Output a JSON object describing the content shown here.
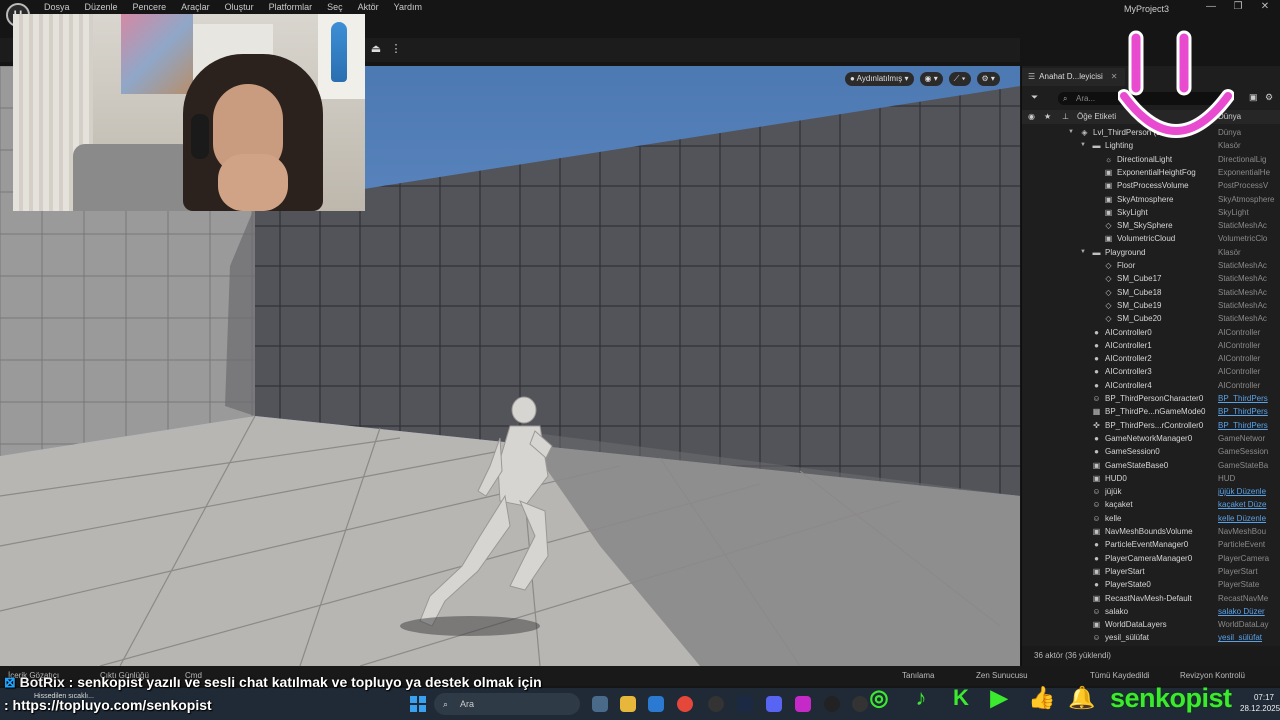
{
  "app": {
    "logo": "U",
    "menus": [
      "Dosya",
      "Düzenle",
      "Pencere",
      "Araçlar",
      "Oluştur",
      "Platformlar",
      "Seç",
      "Aktör",
      "Yardım"
    ],
    "project": "MyProject3",
    "window_controls": [
      "—",
      "❐",
      "✕"
    ]
  },
  "viewport": {
    "lit_mode": "Aydınlatılmış",
    "toolbar_icons": [
      "eye-icon",
      "transform-icon",
      "settings-icon"
    ]
  },
  "outliner": {
    "tab_label": "Anahat D...leyicisi",
    "search_placeholder": "Ara...",
    "header_label": "Öğe Etiketi",
    "header_type": "Dünya",
    "rows": [
      {
        "name": "Lvl_ThirdPerson (Editör)",
        "type": "Dünya",
        "depth": 0,
        "kind": "world",
        "expand": true,
        "link": false
      },
      {
        "name": "Lighting",
        "type": "Klasör",
        "depth": 1,
        "kind": "folder",
        "expand": true,
        "link": false
      },
      {
        "name": "DirectionalLight",
        "type": "DirectionalLig",
        "depth": 2,
        "kind": "light",
        "link": false
      },
      {
        "name": "ExponentialHeightFog",
        "type": "ExponentialHe",
        "depth": 2,
        "kind": "actor",
        "link": false
      },
      {
        "name": "PostProcessVolume",
        "type": "PostProcessV",
        "depth": 2,
        "kind": "actor",
        "link": false
      },
      {
        "name": "SkyAtmosphere",
        "type": "SkyAtmosphere",
        "depth": 2,
        "kind": "actor",
        "link": false
      },
      {
        "name": "SkyLight",
        "type": "SkyLight",
        "depth": 2,
        "kind": "actor",
        "link": false
      },
      {
        "name": "SM_SkySphere",
        "type": "StaticMeshAc",
        "depth": 2,
        "kind": "mesh",
        "link": false
      },
      {
        "name": "VolumetricCloud",
        "type": "VolumetricClo",
        "depth": 2,
        "kind": "actor",
        "link": false
      },
      {
        "name": "Playground",
        "type": "Klasör",
        "depth": 1,
        "kind": "folder",
        "expand": true,
        "link": false
      },
      {
        "name": "Floor",
        "type": "StaticMeshAc",
        "depth": 2,
        "kind": "mesh",
        "link": false
      },
      {
        "name": "SM_Cube17",
        "type": "StaticMeshAc",
        "depth": 2,
        "kind": "mesh",
        "link": false
      },
      {
        "name": "SM_Cube18",
        "type": "StaticMeshAc",
        "depth": 2,
        "kind": "mesh",
        "link": false
      },
      {
        "name": "SM_Cube19",
        "type": "StaticMeshAc",
        "depth": 2,
        "kind": "mesh",
        "link": false
      },
      {
        "name": "SM_Cube20",
        "type": "StaticMeshAc",
        "depth": 2,
        "kind": "mesh",
        "link": false
      },
      {
        "name": "AIController0",
        "type": "AIController",
        "depth": 1,
        "kind": "controller",
        "link": false
      },
      {
        "name": "AIController1",
        "type": "AIController",
        "depth": 1,
        "kind": "controller",
        "link": false
      },
      {
        "name": "AIController2",
        "type": "AIController",
        "depth": 1,
        "kind": "controller",
        "link": false
      },
      {
        "name": "AIController3",
        "type": "AIController",
        "depth": 1,
        "kind": "controller",
        "link": false
      },
      {
        "name": "AIController4",
        "type": "AIController",
        "depth": 1,
        "kind": "controller",
        "link": false
      },
      {
        "name": "BP_ThirdPersonCharacter0",
        "type": "BP_ThirdPers",
        "depth": 1,
        "kind": "pawn",
        "link": true
      },
      {
        "name": "BP_ThirdPe...nGameMode0",
        "type": "BP_ThirdPers",
        "depth": 1,
        "kind": "gamemode",
        "link": true
      },
      {
        "name": "BP_ThirdPers...rController0",
        "type": "BP_ThirdPers",
        "depth": 1,
        "kind": "gamepad",
        "link": true
      },
      {
        "name": "GameNetworkManager0",
        "type": "GameNetwor",
        "depth": 1,
        "kind": "controller",
        "link": false
      },
      {
        "name": "GameSession0",
        "type": "GameSession",
        "depth": 1,
        "kind": "controller",
        "link": false
      },
      {
        "name": "GameStateBase0",
        "type": "GameStateBa",
        "depth": 1,
        "kind": "actor",
        "link": false
      },
      {
        "name": "HUD0",
        "type": "HUD",
        "depth": 1,
        "kind": "actor",
        "link": false
      },
      {
        "name": "jüjük",
        "type": "jüjük Düzenle",
        "depth": 1,
        "kind": "pawn",
        "link": true
      },
      {
        "name": "kaçaket",
        "type": "kaçaket Düze",
        "depth": 1,
        "kind": "pawn",
        "link": true
      },
      {
        "name": "kelle",
        "type": "kelle Düzenle",
        "depth": 1,
        "kind": "pawn",
        "link": true
      },
      {
        "name": "NavMeshBoundsVolume",
        "type": "NavMeshBou",
        "depth": 1,
        "kind": "actor",
        "link": false
      },
      {
        "name": "ParticleEventManager0",
        "type": "ParticleEvent",
        "depth": 1,
        "kind": "controller",
        "link": false
      },
      {
        "name": "PlayerCameraManager0",
        "type": "PlayerCamera",
        "depth": 1,
        "kind": "controller",
        "link": false
      },
      {
        "name": "PlayerStart",
        "type": "PlayerStart",
        "depth": 1,
        "kind": "actor",
        "link": false
      },
      {
        "name": "PlayerState0",
        "type": "PlayerState",
        "depth": 1,
        "kind": "controller",
        "link": false
      },
      {
        "name": "RecastNavMesh-Default",
        "type": "RecastNavMe",
        "depth": 1,
        "kind": "actor",
        "link": false
      },
      {
        "name": "salako",
        "type": "salako Düzer",
        "depth": 1,
        "kind": "pawn",
        "link": true
      },
      {
        "name": "WorldDataLayers",
        "type": "WorldDataLay",
        "depth": 1,
        "kind": "actor",
        "link": false
      },
      {
        "name": "yesil_sülüfat",
        "type": "yesil_sülüfat",
        "depth": 1,
        "kind": "pawn",
        "link": true
      }
    ],
    "status": "36 aktör (36 yüklendi)"
  },
  "statusbar": {
    "items": [
      "İçerik Gözatıcı",
      "Çıktı Günlüğü",
      "Cmd",
      "Tanılama",
      "Zen Sunucusu",
      "Tümü Kaydedildi",
      "Revizyon Kontrolü"
    ]
  },
  "chat": {
    "user": "BotRix",
    "message": ": senkopist yazılı ve sesli chat katılmak ve topluyo ya destek olmak için",
    "url": ": https://topluyo.com/senkopist",
    "note": "Hissedilen sıcaklı..."
  },
  "taskbar": {
    "search_placeholder": "Ara",
    "time": "07:17",
    "date": "28.12.2025"
  },
  "social": {
    "handle": "senkopist",
    "color": "#3bea2e",
    "icons": [
      "instagram-icon",
      "tiktok-icon",
      "kick-icon",
      "youtube-icon",
      "thumbs-up-icon",
      "bell-icon"
    ]
  },
  "colors": {
    "smiley": "#e84bd0"
  }
}
